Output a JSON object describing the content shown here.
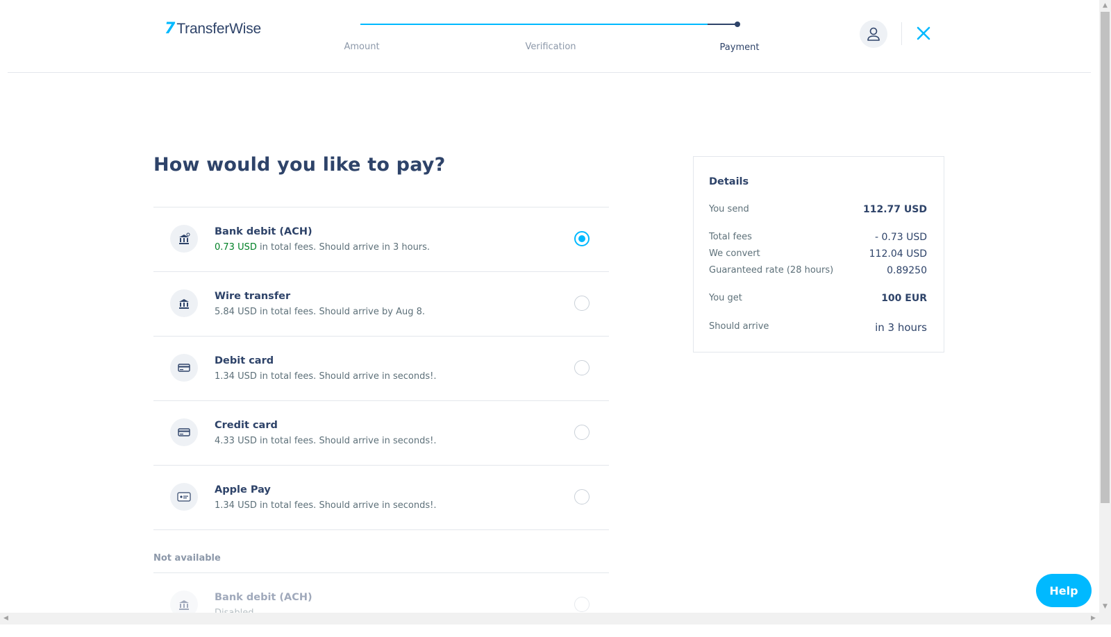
{
  "header": {
    "logo_mark": "7",
    "logo_text": "TransferWise",
    "progress_fraction": 1.0,
    "steps": [
      {
        "label": "Amount"
      },
      {
        "label": "Verification"
      },
      {
        "label": "Payment"
      }
    ],
    "active_step": "Payment",
    "icons": {
      "profile": "user-icon",
      "close": "close-icon"
    }
  },
  "main": {
    "title": "How would you like to pay?",
    "selected_method": "Bank debit (ACH)",
    "options": [
      {
        "title": "Bank debit (ACH)",
        "fee": "0.73 USD",
        "desc": " in total fees. Should arrive in 3 hours.",
        "icon": "bank-debit-icon"
      },
      {
        "title": "Wire transfer",
        "fee": "5.84 USD",
        "desc": " in total fees. Should arrive by Aug 8.",
        "icon": "bank-icon"
      },
      {
        "title": "Debit card",
        "fee": "1.34 USD",
        "desc": " in total fees. Should arrive in seconds!.",
        "icon": "card-icon"
      },
      {
        "title": "Credit card",
        "fee": "4.33 USD",
        "desc": " in total fees. Should arrive in seconds!.",
        "icon": "card-icon"
      },
      {
        "title": "Apple Pay",
        "fee": "1.34 USD",
        "desc": " in total fees. Should arrive in seconds!.",
        "icon": "apple-pay-icon"
      }
    ],
    "not_available_label": "Not available",
    "unavailable": [
      {
        "title": "Bank debit (ACH)",
        "desc": "Disabled",
        "icon": "bank-debit-icon"
      }
    ]
  },
  "details": {
    "title": "Details",
    "you_send_label": "You send",
    "you_send_value": "112.77 USD",
    "total_fees_label": "Total fees",
    "total_fees_value": "- 0.73 USD",
    "we_convert_label": "We convert",
    "we_convert_value": "112.04 USD",
    "rate_label": "Guaranteed rate (28 hours)",
    "rate_value": "0.89250",
    "you_get_label": "You get",
    "you_get_value": "100 EUR",
    "arrive_label": "Should arrive",
    "arrive_value": "in 3 hours"
  },
  "help_label": "Help",
  "colors": {
    "accent": "#00b9ff",
    "navy": "#2e4369",
    "fee_green": "#008026",
    "muted": "#8c98a9"
  }
}
